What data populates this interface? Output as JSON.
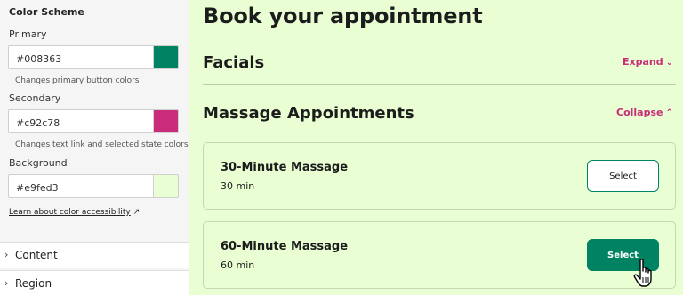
{
  "settings": {
    "section_title": "Color Scheme",
    "primary": {
      "label": "Primary",
      "value": "#008363",
      "help": "Changes primary button colors",
      "swatch": "#008363"
    },
    "secondary": {
      "label": "Secondary",
      "value": "#c92c78",
      "help": "Changes text link and selected state colors",
      "swatch": "#c92c78"
    },
    "background": {
      "label": "Background",
      "value": "#e9fed3",
      "swatch": "#e9fed3"
    },
    "accessibility_link": "Learn about color accessibility",
    "accordion": [
      {
        "label": "Content"
      },
      {
        "label": "Region"
      }
    ]
  },
  "booking": {
    "title": "Book your appointment",
    "categories": [
      {
        "name": "Facials",
        "toggle": "Expand"
      },
      {
        "name": "Massage Appointments",
        "toggle": "Collapse"
      }
    ],
    "services": [
      {
        "name": "30-Minute Massage",
        "duration": "30 min",
        "button": "Select"
      },
      {
        "name": "60-Minute Massage",
        "duration": "60 min",
        "button": "Select"
      }
    ]
  }
}
